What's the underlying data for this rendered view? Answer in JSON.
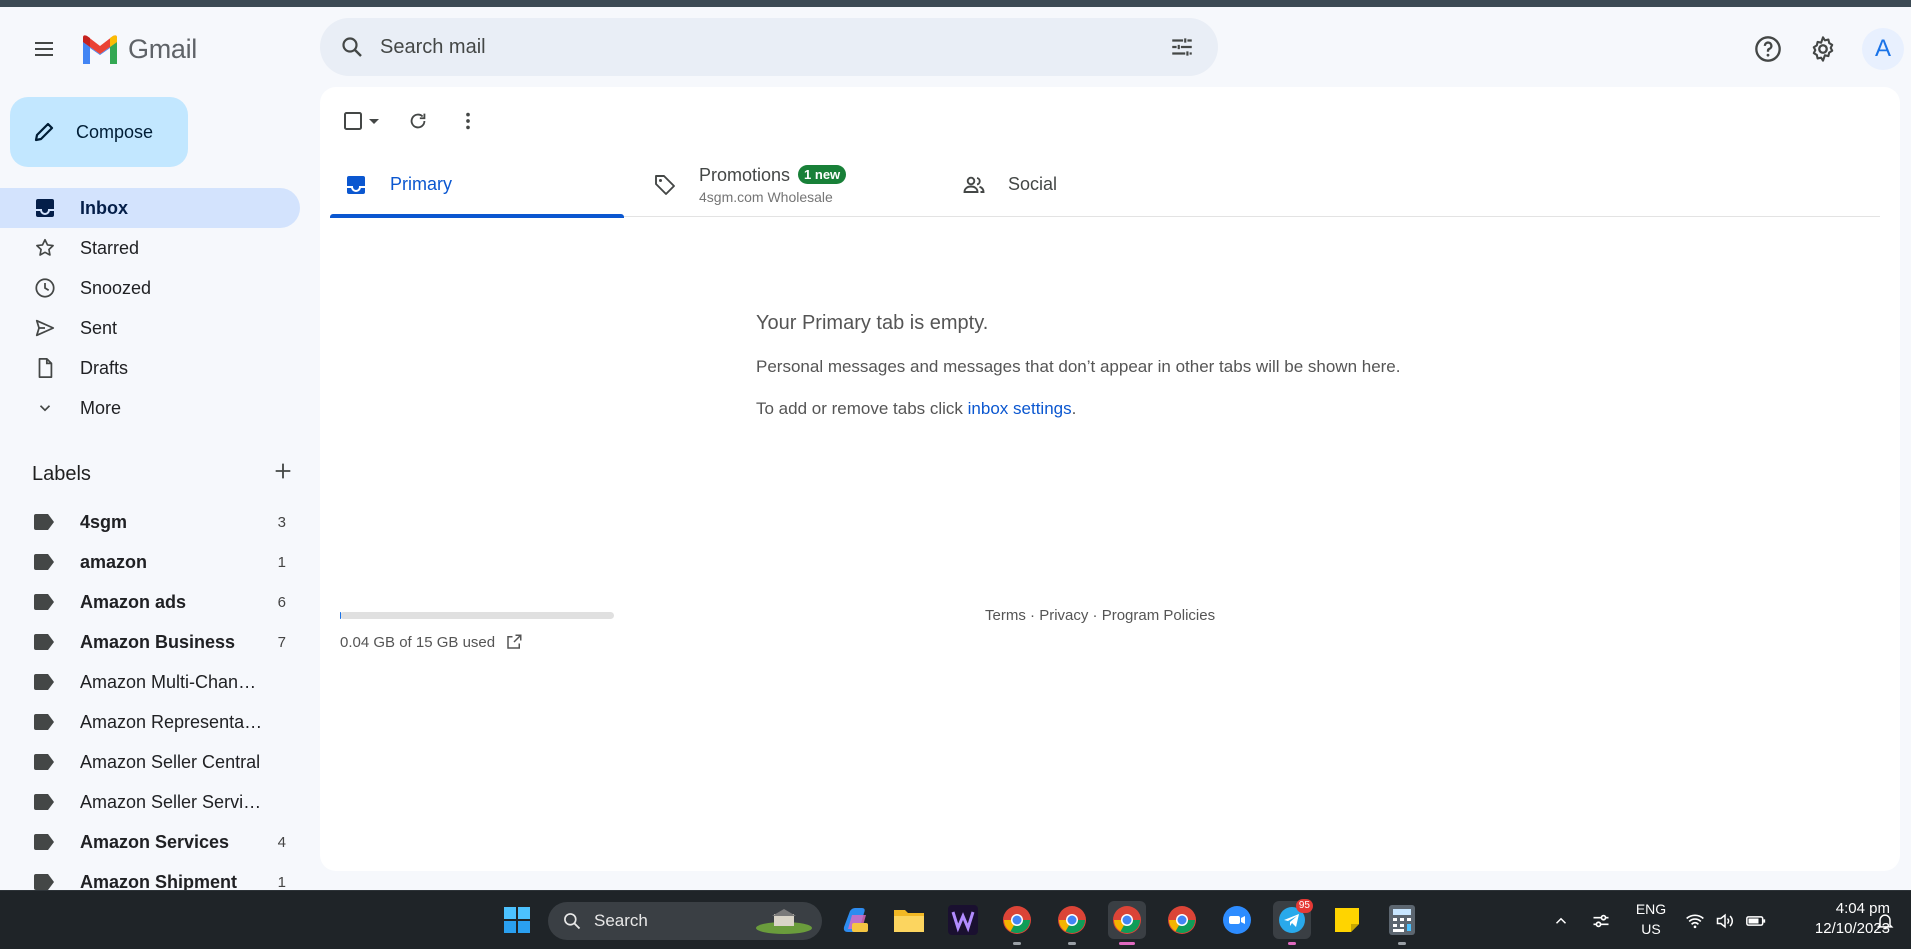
{
  "app": {
    "name": "Gmail"
  },
  "search": {
    "placeholder": "Search mail"
  },
  "header": {
    "avatar_letter": "A"
  },
  "compose": {
    "label": "Compose"
  },
  "nav": [
    {
      "label": "Inbox",
      "icon": "inbox-icon",
      "active": true
    },
    {
      "label": "Starred",
      "icon": "star-icon"
    },
    {
      "label": "Snoozed",
      "icon": "clock-icon"
    },
    {
      "label": "Sent",
      "icon": "send-icon"
    },
    {
      "label": "Drafts",
      "icon": "draft-icon"
    },
    {
      "label": "More",
      "icon": "chevron-down-icon"
    }
  ],
  "labels": {
    "title": "Labels",
    "items": [
      {
        "name": "4sgm",
        "count": "3",
        "bold": true
      },
      {
        "name": "amazon",
        "count": "1",
        "bold": true
      },
      {
        "name": "Amazon ads",
        "count": "6",
        "bold": true
      },
      {
        "name": "Amazon Business",
        "count": "7",
        "bold": true
      },
      {
        "name": "Amazon Multi-Channel ...",
        "count": "",
        "bold": false
      },
      {
        "name": "Amazon Representative",
        "count": "",
        "bold": false
      },
      {
        "name": "Amazon Seller Central",
        "count": "",
        "bold": false
      },
      {
        "name": "Amazon Seller Services",
        "count": "",
        "bold": false
      },
      {
        "name": "Amazon Services",
        "count": "4",
        "bold": true
      },
      {
        "name": "Amazon Shipment",
        "count": "1",
        "bold": true
      }
    ]
  },
  "tabs": {
    "primary": "Primary",
    "promotions": "Promotions",
    "promotions_badge": "1 new",
    "promotions_sub": "4sgm.com Wholesale",
    "social": "Social"
  },
  "empty": {
    "heading": "Your Primary tab is empty.",
    "line1": "Personal messages and messages that don’t appear in other tabs will be shown here.",
    "line2_prefix": "To add or remove tabs click ",
    "line2_link": "inbox settings",
    "line2_suffix": "."
  },
  "storage": {
    "text": "0.04 GB of 15 GB used",
    "used_fraction": 0.003
  },
  "footer": {
    "terms": "Terms",
    "privacy": "Privacy",
    "policies": "Program Policies",
    "sep": " · "
  },
  "taskbar": {
    "search_label": "Search",
    "lang_top": "ENG",
    "lang_bottom": "US",
    "time": "4:04 pm",
    "date": "12/10/2023",
    "telegram_badge": "95"
  },
  "colors": {
    "accent": "#0b57d0",
    "compose_bg": "#c2e7ff",
    "active_nav": "#d3e3fd",
    "badge_green": "#188038"
  }
}
